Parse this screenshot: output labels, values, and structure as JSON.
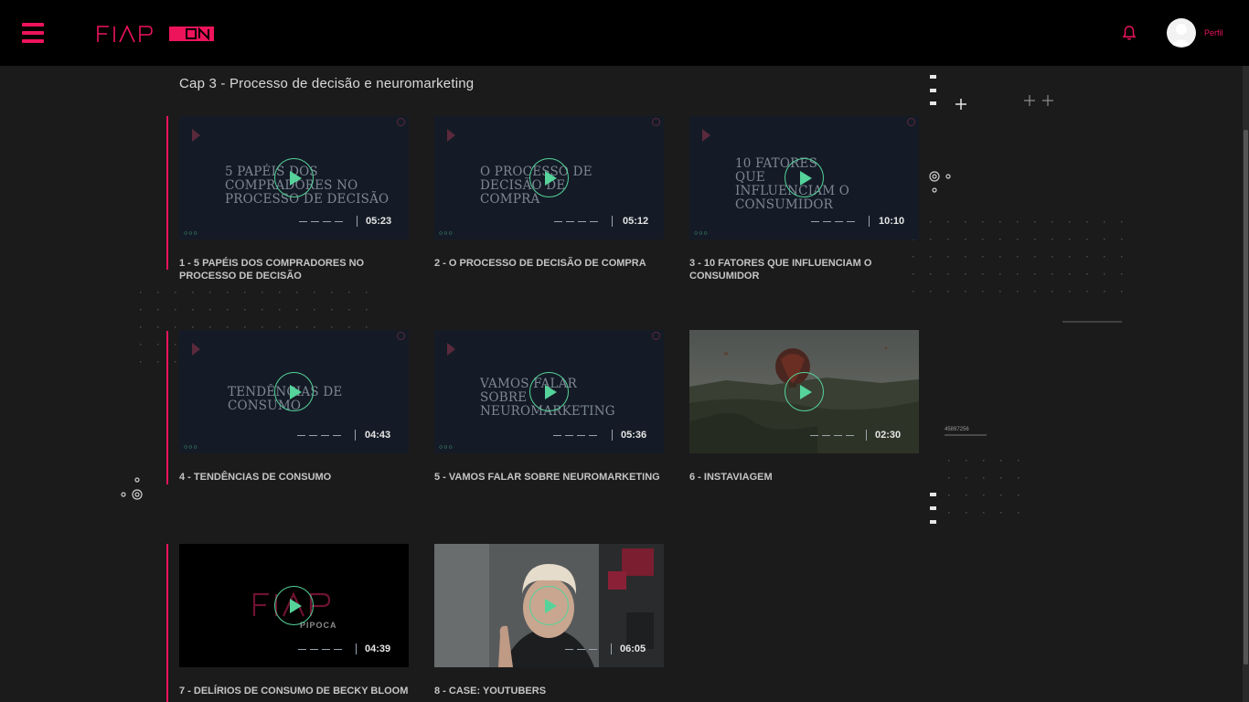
{
  "header": {
    "brand_name": "FIAP ON",
    "profile_label": "Perfil",
    "icons": {
      "menu": "hamburger-icon",
      "notifications": "bell-icon",
      "profile": "avatar-icon"
    },
    "colors": {
      "brand": "#ed145b",
      "accent_play": "#55d39a",
      "background": "#1b1b1c",
      "topbar": "#000000"
    }
  },
  "chapter": {
    "title": "Cap 3 - Processo de decisão e neuromarketing"
  },
  "decor": {
    "code_label": "45897256"
  },
  "videos": [
    {
      "title": "1 - 5 PAPÉIS DOS COMPRADORES NO PROCESSO DE DECISÃO",
      "thumb_text": "5 PAPÉIS DOS COMPRADORES NO PROCESSO DE DECISÃO",
      "duration": "05:23"
    },
    {
      "title": "2 - O PROCESSO DE DECISÃO DE COMPRA",
      "thumb_text": "O PROCESSO DE DECISÃO DE COMPRA",
      "duration": "05:12"
    },
    {
      "title": "3 - 10 FATORES QUE INFLUENCIAM O CONSUMIDOR",
      "thumb_text": "10 FATORES QUE INFLUENCIAM O CONSUMIDOR",
      "duration": "10:10"
    },
    {
      "title": "4 - TENDÊNCIAS DE CONSUMO",
      "thumb_text": "TENDÊNCIAS DE CONSUMO",
      "duration": "04:43"
    },
    {
      "title": "5 - VAMOS FALAR SOBRE NEUROMARKETING",
      "thumb_text": "VAMOS FALAR SOBRE NEUROMARKETING",
      "duration": "05:36"
    },
    {
      "title": "6 - INSTAVIAGEM",
      "thumb_text": "",
      "duration": "02:30"
    },
    {
      "title": "7 - DELÍRIOS DE CONSUMO DE BECKY BLOOM",
      "thumb_text": "PIPOCA",
      "duration": "04:39"
    },
    {
      "title": "8 - CASE: YOUTUBERS",
      "thumb_text": "",
      "duration": "06:05"
    }
  ]
}
